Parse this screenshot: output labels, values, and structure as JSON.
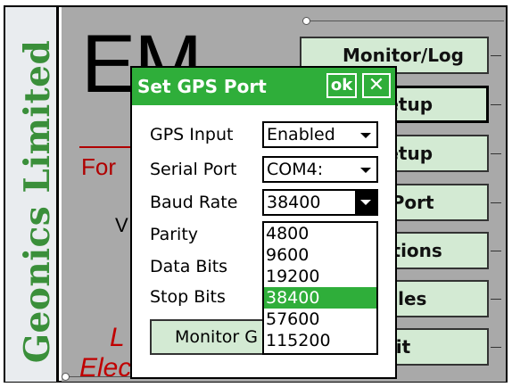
{
  "brand": {
    "text": "Geonics Limited"
  },
  "background": {
    "title": "EM",
    "subtitle": "For",
    "v_text": "V",
    "l_text": "L",
    "elec_text": "Elec"
  },
  "menu": {
    "items": [
      {
        "label": "Monitor/Log"
      },
      {
        "label": "Setup"
      },
      {
        "label": "Setup"
      },
      {
        "label": "S Port"
      },
      {
        "label": "Options"
      },
      {
        "label": "Files"
      },
      {
        "label": "it"
      }
    ]
  },
  "dialog": {
    "title": "Set GPS Port",
    "ok_label": "ok",
    "close_label": "✕",
    "fields": {
      "gps_input": {
        "label": "GPS Input",
        "value": "Enabled"
      },
      "serial_port": {
        "label": "Serial Port",
        "value": "COM4:"
      },
      "baud_rate": {
        "label": "Baud Rate",
        "value": "38400"
      },
      "parity": {
        "label": "Parity"
      },
      "data_bits": {
        "label": "Data Bits"
      },
      "stop_bits": {
        "label": "Stop Bits"
      }
    },
    "baud_options": [
      "4800",
      "9600",
      "19200",
      "38400",
      "57600",
      "115200"
    ],
    "baud_selected": "38400",
    "monitor_button": "Monitor G"
  },
  "colors": {
    "accent_green": "#2fae3a",
    "button_green": "#d3ead3",
    "brand_green": "#3a8f3a",
    "red_text": "#c00000"
  }
}
